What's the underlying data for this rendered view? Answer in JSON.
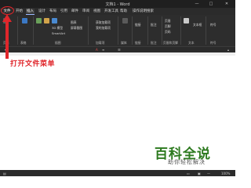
{
  "titlebar": {
    "title": "文档1 - Word"
  },
  "tabs": [
    {
      "label": "文件"
    },
    {
      "label": "开始"
    },
    {
      "label": "插入"
    },
    {
      "label": "设计"
    },
    {
      "label": "布局"
    },
    {
      "label": "引用"
    },
    {
      "label": "邮件"
    },
    {
      "label": "审阅"
    },
    {
      "label": "视图"
    },
    {
      "label": "开发工具"
    },
    {
      "label": "帮助"
    },
    {
      "label": "操作说明搜索"
    }
  ],
  "ribbon": {
    "items": [
      "3D 模型",
      "SmartArt",
      "图表",
      "屏幕截图",
      "获取加载项",
      "我的加载项",
      "链接",
      "批注",
      "页眉",
      "页脚",
      "页码",
      "文本框",
      "符号"
    ],
    "groups": [
      "页面",
      "表格",
      "插图",
      "加载项",
      "媒体",
      "链接",
      "批注",
      "页眉和页脚",
      "文本",
      "符号"
    ]
  },
  "annotation": {
    "text": "打开文件菜单"
  },
  "watermark": {
    "main": "百科全说",
    "sub": "助你轻松解决"
  },
  "statusbar": {
    "zoom": "100%"
  },
  "colors": {
    "accent_red": "#e0262b",
    "watermark_green": "#2d7a1f",
    "titlebar": "#1f1f1f",
    "ribbon": "#2d2d2d"
  }
}
